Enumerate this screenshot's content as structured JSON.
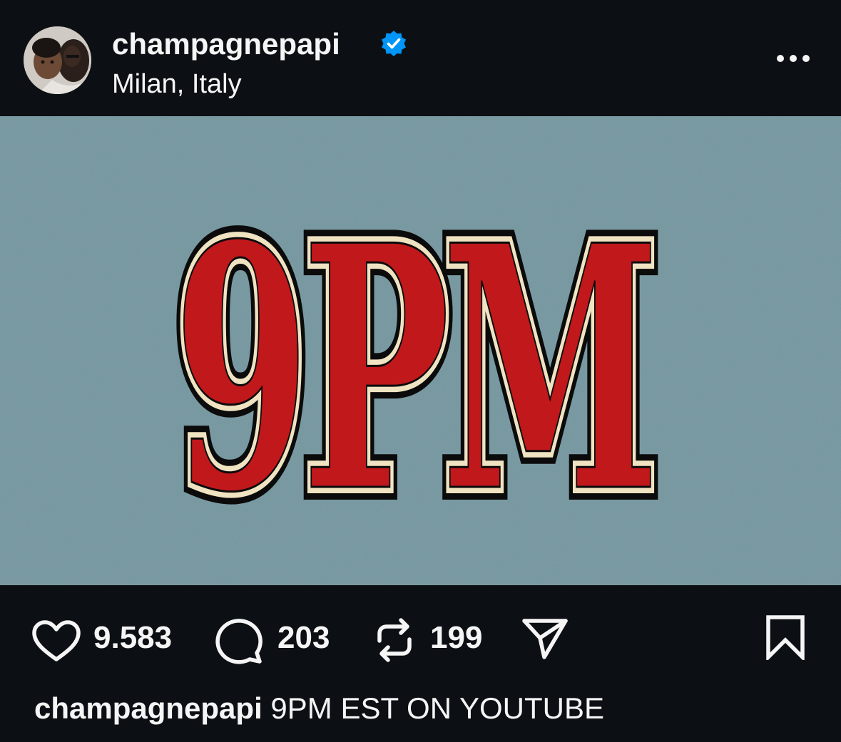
{
  "post": {
    "username": "champagnepapi",
    "location": "Milan, Italy",
    "image_text": "9PM",
    "likes": "9.583",
    "comments": "203",
    "reposts": "199",
    "caption_user": "champagnepapi",
    "caption_text": "9PM EST ON YOUTUBE"
  },
  "icons": {
    "verified": "verified-badge-icon",
    "more": "more-options-icon",
    "like": "heart-icon",
    "comment": "comment-icon",
    "repost": "repost-icon",
    "share": "send-icon",
    "save": "bookmark-icon"
  },
  "colors": {
    "background": "#0c1014",
    "image_bg": "#7597a0",
    "letter_red": "#c0181b",
    "letter_cream": "#efe3c2",
    "verified_blue": "#0095f6"
  }
}
